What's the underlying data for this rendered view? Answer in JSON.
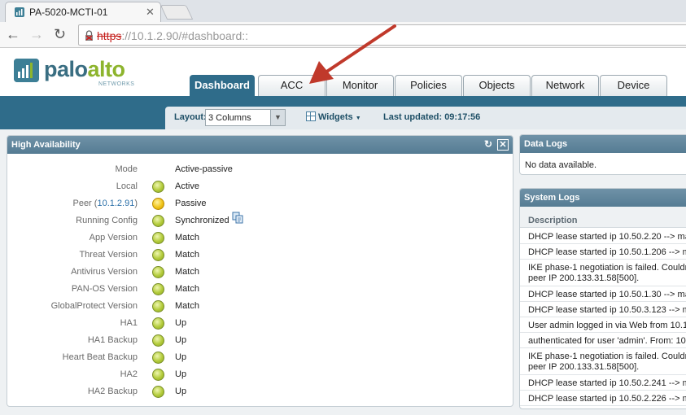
{
  "browser": {
    "tab_title": "PA-5020-MCTI-01",
    "url_scheme": "https",
    "url_rest": "://10.1.2.90/#dashboard::"
  },
  "header": {
    "logo_main": "palo",
    "logo_alt": "alto",
    "logo_sub": "NETWORKS",
    "tabs": [
      {
        "label": "Dashboard",
        "active": true
      },
      {
        "label": "ACC"
      },
      {
        "label": "Monitor"
      },
      {
        "label": "Policies"
      },
      {
        "label": "Objects"
      },
      {
        "label": "Network"
      },
      {
        "label": "Device"
      }
    ]
  },
  "layout_bar": {
    "layout_label": "Layout:",
    "layout_value": "3 Columns",
    "widgets_label": "Widgets",
    "last_updated_label": "Last updated:",
    "last_updated_value": "09:17:56"
  },
  "ha_widget": {
    "title": "High Availability",
    "rows": [
      {
        "label": "Mode",
        "value": "Active-passive",
        "status": "none"
      },
      {
        "label": "Local",
        "value": "Active",
        "status": "green"
      },
      {
        "label_prefix": "Peer (",
        "label_link": "10.1.2.91",
        "label_suffix": ")",
        "value": "Passive",
        "status": "yellow"
      },
      {
        "label": "Running Config",
        "value": "Synchronized",
        "status": "green"
      },
      {
        "label": "App Version",
        "value": "Match",
        "status": "green"
      },
      {
        "label": "Threat Version",
        "value": "Match",
        "status": "green"
      },
      {
        "label": "Antivirus Version",
        "value": "Match",
        "status": "green"
      },
      {
        "label": "PAN-OS Version",
        "value": "Match",
        "status": "green"
      },
      {
        "label": "GlobalProtect Version",
        "value": "Match",
        "status": "green"
      },
      {
        "label": "HA1",
        "value": "Up",
        "status": "green"
      },
      {
        "label": "HA1 Backup",
        "value": "Up",
        "status": "green"
      },
      {
        "label": "Heart Beat Backup",
        "value": "Up",
        "status": "green"
      },
      {
        "label": "HA2",
        "value": "Up",
        "status": "green"
      },
      {
        "label": "HA2 Backup",
        "value": "Up",
        "status": "green"
      }
    ]
  },
  "data_logs": {
    "title": "Data Logs",
    "empty_text": "No data available."
  },
  "system_logs": {
    "title": "System Logs",
    "column": "Description",
    "entries": [
      "DHCP lease started ip 10.50.2.20 --> ma",
      "DHCP lease started ip 10.50.1.206 --> m",
      "IKE phase-1 negotiation is failed. Couldn\npeer IP 200.133.31.58[500].",
      "DHCP lease started ip 10.50.1.30 --> ma",
      "DHCP lease started ip 10.50.3.123 --> m",
      "User admin logged in via Web from 10.1",
      "authenticated for user 'admin'. From: 10",
      "IKE phase-1 negotiation is failed. Couldn\npeer IP 200.133.31.58[500].",
      "DHCP lease started ip 10.50.2.241 --> m",
      "DHCP lease started ip 10.50.2.226 --> m"
    ]
  },
  "colors": {
    "nav_blue": "#2f6c8a",
    "status_green": "#b3cb3a",
    "status_yellow": "#f0c419",
    "annotation_red": "#c0392b"
  }
}
